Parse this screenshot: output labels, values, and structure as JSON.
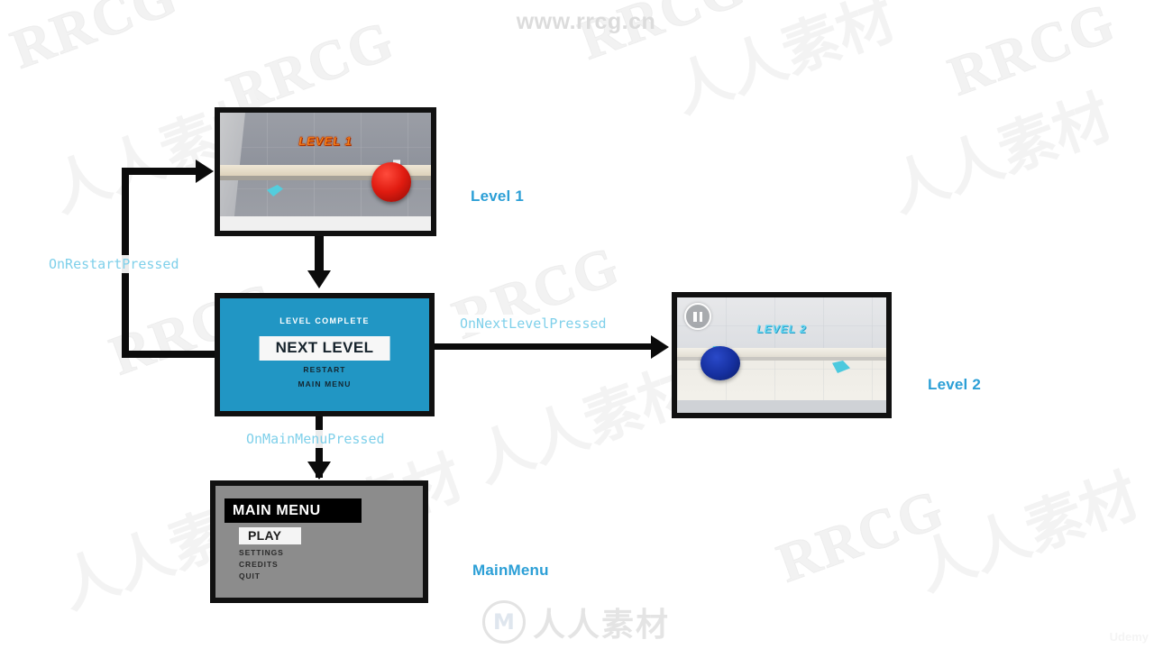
{
  "diagram": {
    "title": "Game state machine flow diagram",
    "accent_state_color": "#2c9fd6",
    "accent_transition_color": "#7fd0ea",
    "connector_color": "#0b0b0b"
  },
  "states": {
    "level1": {
      "label": "Level 1",
      "screen": {
        "title": "LEVEL 1",
        "ball_color": "#e01b10",
        "blade_color": "#4fd0e0"
      }
    },
    "level_complete": {
      "title": "LEVEL COMPLETE",
      "primary_button": "NEXT LEVEL",
      "options": [
        "RESTART",
        "MAIN MENU"
      ],
      "background_color": "#2196c4"
    },
    "level2": {
      "label": "Level 2",
      "screen": {
        "title": "LEVEL 2",
        "ball_color": "#152f9e",
        "pause_icon": "pause-icon"
      }
    },
    "main_menu": {
      "label": "MainMenu",
      "screen": {
        "banner": "MAIN MENU",
        "primary_button": "PLAY",
        "options": [
          "SETTINGS",
          "CREDITS",
          "QUIT"
        ],
        "background_color": "#8c8c8c"
      }
    }
  },
  "transitions": {
    "restart": "OnRestartPressed",
    "next_level": "OnNextLevelPressed",
    "main_menu": "OnMainMenuPressed"
  },
  "watermarks": {
    "top_url": "www.rrcg.cn",
    "diagonal_latin": "RRCG",
    "diagonal_cjk": "人人素材",
    "bottom_brand": "人人素材",
    "bottom_logo": "M",
    "corner_brand": "Udemy"
  }
}
